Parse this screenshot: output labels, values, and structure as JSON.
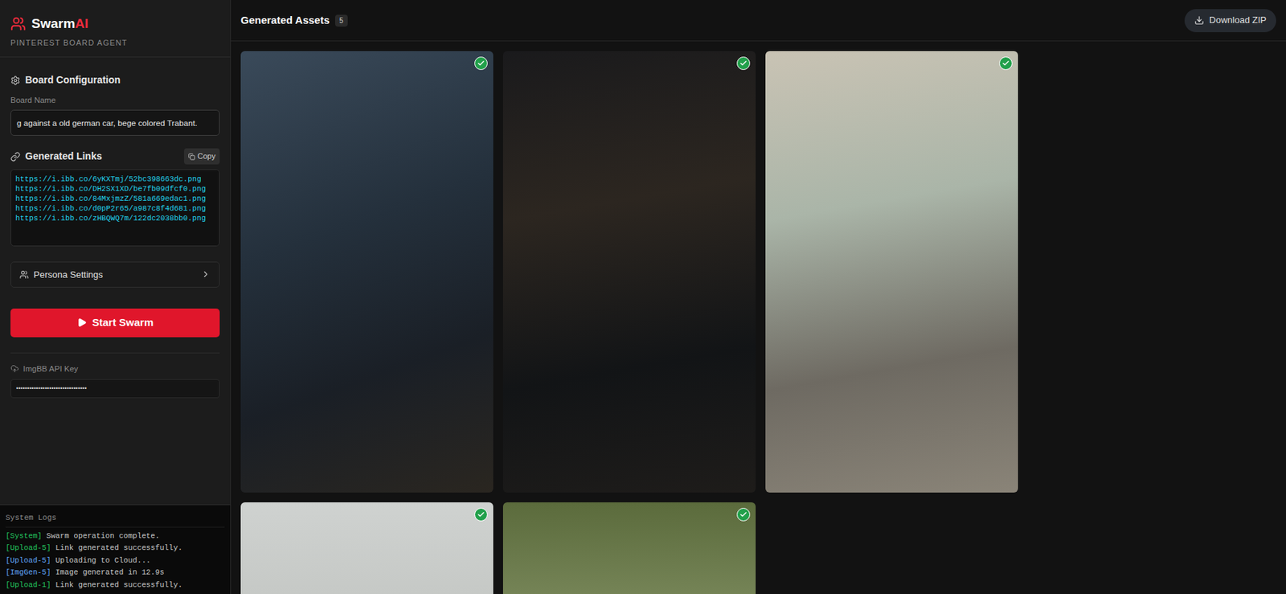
{
  "app": {
    "logo": {
      "name": "Swarm",
      "accent": "AI"
    },
    "subtitle": "PINTEREST BOARD AGENT"
  },
  "sidebar": {
    "section_title": "Board Configuration",
    "board_name": {
      "label": "Board Name",
      "value": "g against a old german car, bege colored Trabant."
    },
    "links": {
      "title": "Generated Links",
      "copy_button": "Copy",
      "items": [
        "https://i.ibb.co/6yKXTmj/52bc398663dc.png",
        "https://i.ibb.co/DH2SX1XD/be7fb09dfcf0.png",
        "https://i.ibb.co/84MxjmzZ/581a669edac1.png",
        "https://i.ibb.co/d0pP2r65/a987c8f4d681.png",
        "https://i.ibb.co/zHBQWQ7m/122dc2038bb0.png"
      ]
    },
    "persona": {
      "label": "Persona Settings",
      "expanded": false
    },
    "start_button": "Start Swarm",
    "api_key": {
      "label": "ImgBB API Key",
      "value": "••••••••••••••••••••••••••••••••"
    }
  },
  "logs": {
    "title": "System Logs",
    "entries": [
      {
        "tag": "[System]",
        "message": "Swarm operation complete.",
        "color": "#22c55e"
      },
      {
        "tag": "[Upload-5]",
        "message": "Link generated successfully.",
        "color": "#22c55e"
      },
      {
        "tag": "[Upload-5]",
        "message": "Uploading to Cloud...",
        "color": "#60a5fa"
      },
      {
        "tag": "[ImgGen-5]",
        "message": "Image generated in 12.9s",
        "color": "#60a5fa"
      },
      {
        "tag": "[Upload-1]",
        "message": "Link generated successfully.",
        "color": "#22c55e"
      }
    ]
  },
  "main": {
    "title": "Generated Assets",
    "count": "5",
    "download_button": "Download ZIP",
    "assets": [
      {
        "done": true
      },
      {
        "done": true
      },
      {
        "done": true
      },
      {
        "done": true
      },
      {
        "done": true
      }
    ]
  }
}
